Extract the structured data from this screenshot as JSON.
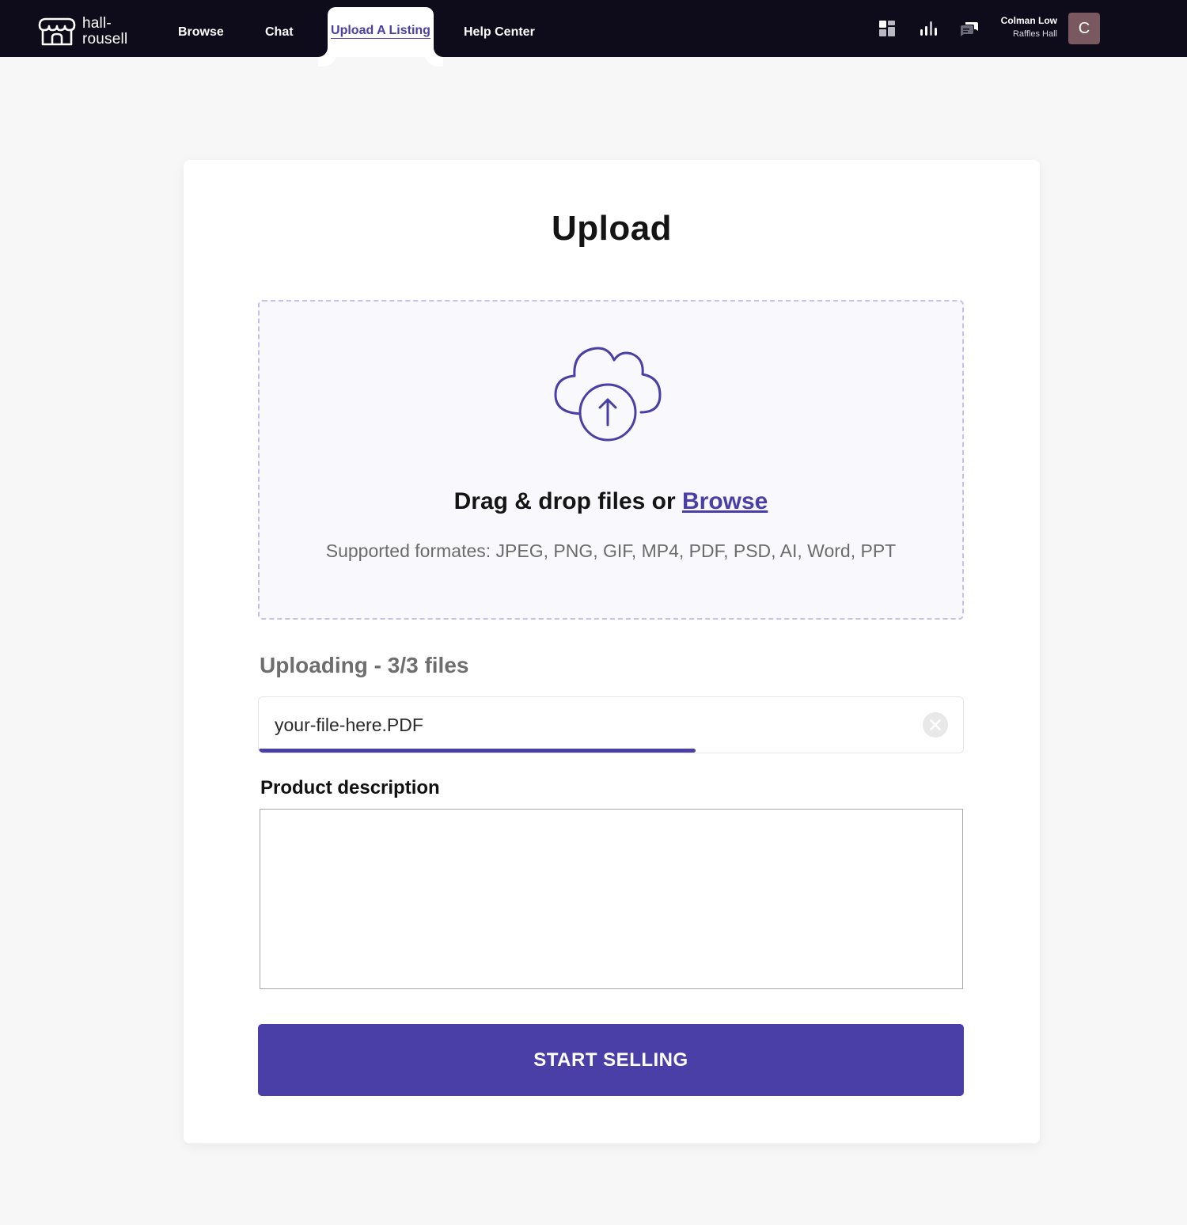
{
  "brand": {
    "name_line1": "hall-",
    "name_line2": "rousell",
    "icon": "storefront-icon"
  },
  "nav": {
    "items": [
      {
        "label": "Browse"
      },
      {
        "label": "Chat"
      },
      {
        "label": "Upload A Listing",
        "active": true
      },
      {
        "label": "Help Center"
      }
    ],
    "icons": [
      "dashboard-icon",
      "stats-icon",
      "messages-icon"
    ]
  },
  "user": {
    "name": "Colman Low",
    "hall": "Raffles Hall",
    "avatar_initial": "C",
    "avatar_color": "#7a5860"
  },
  "upload": {
    "title": "Upload",
    "drop_prefix": "Drag & drop files or ",
    "browse_label": "Browse",
    "formats": "Supported formates: JPEG, PNG, GIF, MP4, PDF, PSD, AI, Word, PPT",
    "uploading_status": "Uploading - 3/3 files",
    "file": {
      "name": "your-file-here.PDF",
      "progress_percent": 62
    }
  },
  "description": {
    "label": "Product description",
    "value": ""
  },
  "actions": {
    "submit_label": "START SELLING"
  },
  "colors": {
    "accent": "#4a3ea7",
    "navbar": "#0e0b1a",
    "background": "#f7f7f7"
  }
}
